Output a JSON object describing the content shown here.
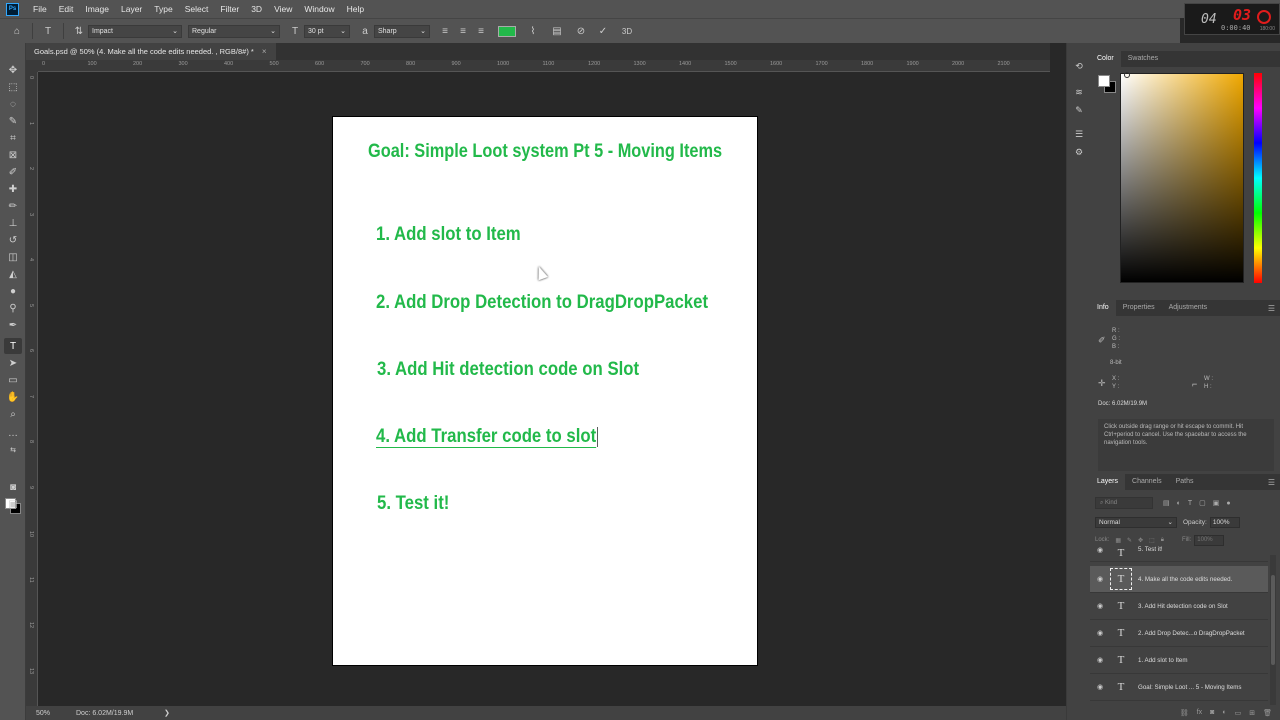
{
  "app": {
    "logo": "Ps"
  },
  "menu": [
    "File",
    "Edit",
    "Image",
    "Layer",
    "Type",
    "Select",
    "Filter",
    "3D",
    "View",
    "Window",
    "Help"
  ],
  "timer": {
    "minutes": "04",
    "seconds": "03",
    "elapsed": "0:00:40",
    "max_label": "180:00"
  },
  "options_bar": {
    "font_family": "Impact",
    "font_style": "Regular",
    "font_size": "30 pt",
    "antialias": "Sharp",
    "text_color": "#22b94a",
    "label_3d": "3D"
  },
  "document_tab": {
    "title": "Goals.psd @ 50% (4. Make all the code edits needed. , RGB/8#) *",
    "close": "×"
  },
  "rulers": {
    "top": [
      "0",
      "100",
      "200",
      "300",
      "400",
      "500",
      "600",
      "700",
      "800",
      "900",
      "1000",
      "1100",
      "1200",
      "1300",
      "1400",
      "1500",
      "1600",
      "1700",
      "1800",
      "1900",
      "2000",
      "2100"
    ],
    "left": [
      "0",
      "1",
      "2",
      "3",
      "4",
      "5",
      "6",
      "7",
      "8",
      "9",
      "10",
      "11",
      "12",
      "13"
    ]
  },
  "canvas": {
    "title": "Goal: Simple Loot system Pt 5 - Moving Items",
    "items": [
      "1. Add slot to Item",
      "2. Add Drop Detection to DragDropPacket",
      "3. Add Hit detection code on Slot",
      "4. Add Transfer code to slot",
      "5. Test it!"
    ],
    "text_color": "#22b94a"
  },
  "status_bar": {
    "zoom": "50%",
    "doc_size": "Doc: 6.02M/19.9M",
    "arrow": "❯"
  },
  "color_panel": {
    "tabs": [
      "Color",
      "Swatches"
    ]
  },
  "info_panel": {
    "tabs": [
      "Info",
      "Properties",
      "Adjustments"
    ],
    "rgb_labels": [
      "R :",
      "G :",
      "B :"
    ],
    "bit_depth": "8-bit",
    "xy_labels": [
      "X :",
      "Y :"
    ],
    "wh_labels": [
      "W :",
      "H :"
    ],
    "doc_size": "Doc: 6.02M/19.9M",
    "hint": "Click outside drag range or hit escape to commit. Hit Ctrl+period to cancel. Use the spacebar to access the navigation tools."
  },
  "layers_panel": {
    "tabs": [
      "Layers",
      "Channels",
      "Paths"
    ],
    "kind_placeholder": "Kind",
    "blend_mode": "Normal",
    "opacity_label": "Opacity:",
    "opacity_value": "100%",
    "lock_label": "Lock:",
    "fill_label": "Fill:",
    "fill_value": "100%",
    "layers": [
      {
        "name": "5. Test it!",
        "selected": false
      },
      {
        "name": "4. Make all the code edits needed.",
        "selected": true
      },
      {
        "name": "3. Add Hit detection code on Slot",
        "selected": false
      },
      {
        "name": "2. Add Drop Detec...o DragDropPacket",
        "selected": false
      },
      {
        "name": "1. Add slot to Item",
        "selected": false
      },
      {
        "name": "Goal: Simple Loot ... 5 - Moving Items",
        "selected": false
      }
    ]
  }
}
